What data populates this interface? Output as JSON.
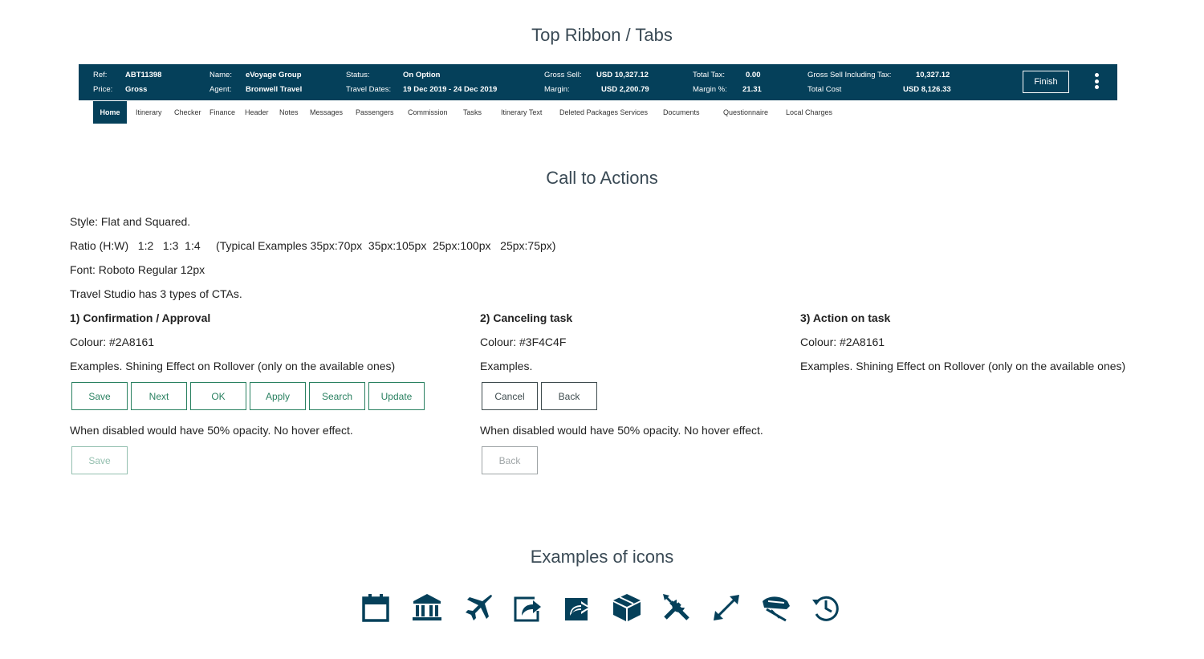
{
  "titles": {
    "ribbon": "Top Ribbon / Tabs",
    "cta": "Call to Actions",
    "icons": "Examples of icons"
  },
  "ribbon": {
    "ref_label": "Ref:",
    "ref_value": "ABT11398",
    "price_label": "Price:",
    "price_value": "Gross",
    "name_label": "Name:",
    "name_value": "eVoyage Group",
    "agent_label": "Agent:",
    "agent_value": "Bronwell Travel",
    "status_label": "Status:",
    "status_value": "On Option",
    "dates_label": "Travel Dates:",
    "dates_value": "19 Dec 2019 - 24 Dec 2019",
    "gross_sell_label": "Gross Sell:",
    "gross_sell_value": "USD 10,327.12",
    "margin_label": "Margin:",
    "margin_value": "USD 2,200.79",
    "total_tax_label": "Total Tax:",
    "total_tax_value": "0.00",
    "margin_pct_label": "Margin %:",
    "margin_pct_value": "21.31",
    "gross_incl_label": "Gross Sell Including Tax:",
    "gross_incl_value": "10,327.12",
    "total_cost_label": "Total Cost",
    "total_cost_value": "USD 8,126.33",
    "finish_label": "Finish",
    "background_color": "#05405A"
  },
  "tabs": [
    "Home",
    "Itinerary",
    "Checker",
    "Finance",
    "Header",
    "Notes",
    "Messages",
    "Passengers",
    "Commission",
    "Tasks",
    "Itinerary Text",
    "Deleted Packages Services",
    "Documents",
    "Questionnaire",
    "Local Charges"
  ],
  "info": {
    "style": "Style: Flat and Squared.",
    "ratio": "Ratio (H:W)   1:2   1:3  1:4     (Typical Examples 35px:70px  35px:105px  25px:100px   25px:75px)",
    "font": "Font: Roboto Regular 12px",
    "types": "Travel Studio has 3 types of CTAs."
  },
  "confirmation": {
    "heading": "1) Confirmation / Approval",
    "colour": "Colour: #2A8161",
    "examples": "Examples.  Shining Effect on Rollover (only on the available ones)",
    "buttons": [
      "Save",
      "Next",
      "OK",
      "Apply",
      "Search",
      "Update"
    ],
    "disabled_note": "When disabled would have 50% opacity. No hover effect.",
    "disabled_button": "Save",
    "color": "#2A8161"
  },
  "canceling": {
    "heading": "2) Canceling task",
    "colour": "Colour: #3F4C4F",
    "examples": "Examples.",
    "buttons": [
      "Cancel",
      "Back"
    ],
    "disabled_note": "When disabled would have 50% opacity. No hover effect.",
    "disabled_button": "Back",
    "color": "#3F4C4F"
  },
  "action": {
    "heading": "3) Action on task",
    "colour": "Colour: #2A8161",
    "examples": "Examples. Shining Effect on Rollover (only on the available ones)"
  },
  "icons": [
    "calendar-icon",
    "bank-icon",
    "airplane-icon",
    "share-icon",
    "export-icon",
    "package-icon",
    "tools-icon",
    "resize-icon",
    "train-icon",
    "history-icon"
  ],
  "icon_color": "#05405A"
}
